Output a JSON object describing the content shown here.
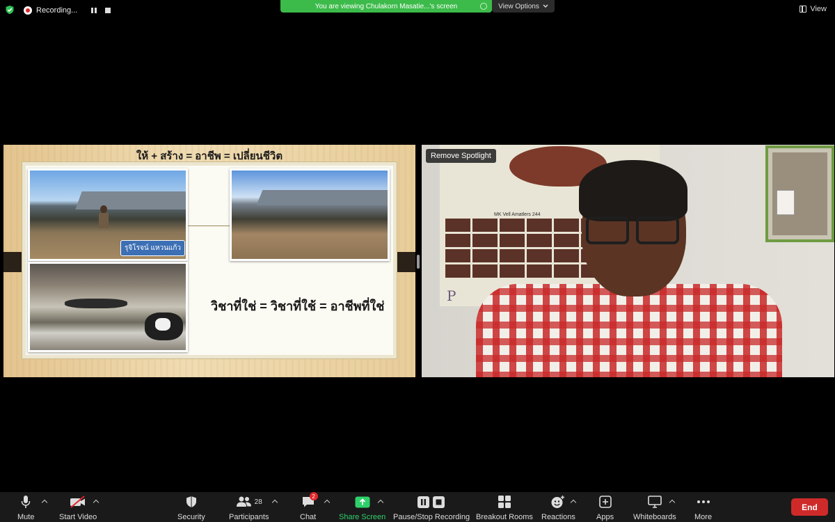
{
  "topbar": {
    "recording_label": "Recording...",
    "viewing_banner": "You are viewing Chulakorn Masatie...'s screen",
    "view_options_label": "View Options",
    "view_label": "View"
  },
  "shared_screen": {
    "slide_title": "ให้ + สร้าง = อาชีพ = เปลี่ยนชีวิต",
    "photo_caption": "รุจิโรจน์ แหวนแก้ว",
    "motto": "วิชาที่ใช่ = วิชาที่ใช้ = อาชีพที่ใช่"
  },
  "video": {
    "remove_spotlight_label": "Remove Spotlight",
    "poster_text": "MK Vell Amatlers 244",
    "poster_letter": "P"
  },
  "toolbar": {
    "mute": "Mute",
    "start_video": "Start Video",
    "security": "Security",
    "participants": "Participants",
    "participants_count": "28",
    "chat": "Chat",
    "chat_badge": "2",
    "share_screen": "Share Screen",
    "pause_stop_recording": "Pause/Stop Recording",
    "breakout_rooms": "Breakout Rooms",
    "reactions": "Reactions",
    "apps": "Apps",
    "whiteboards": "Whiteboards",
    "more": "More",
    "end": "End"
  },
  "colors": {
    "share_green": "#2fd06b",
    "end_red": "#cf2a2a",
    "banner_green": "#3cbb4a"
  }
}
